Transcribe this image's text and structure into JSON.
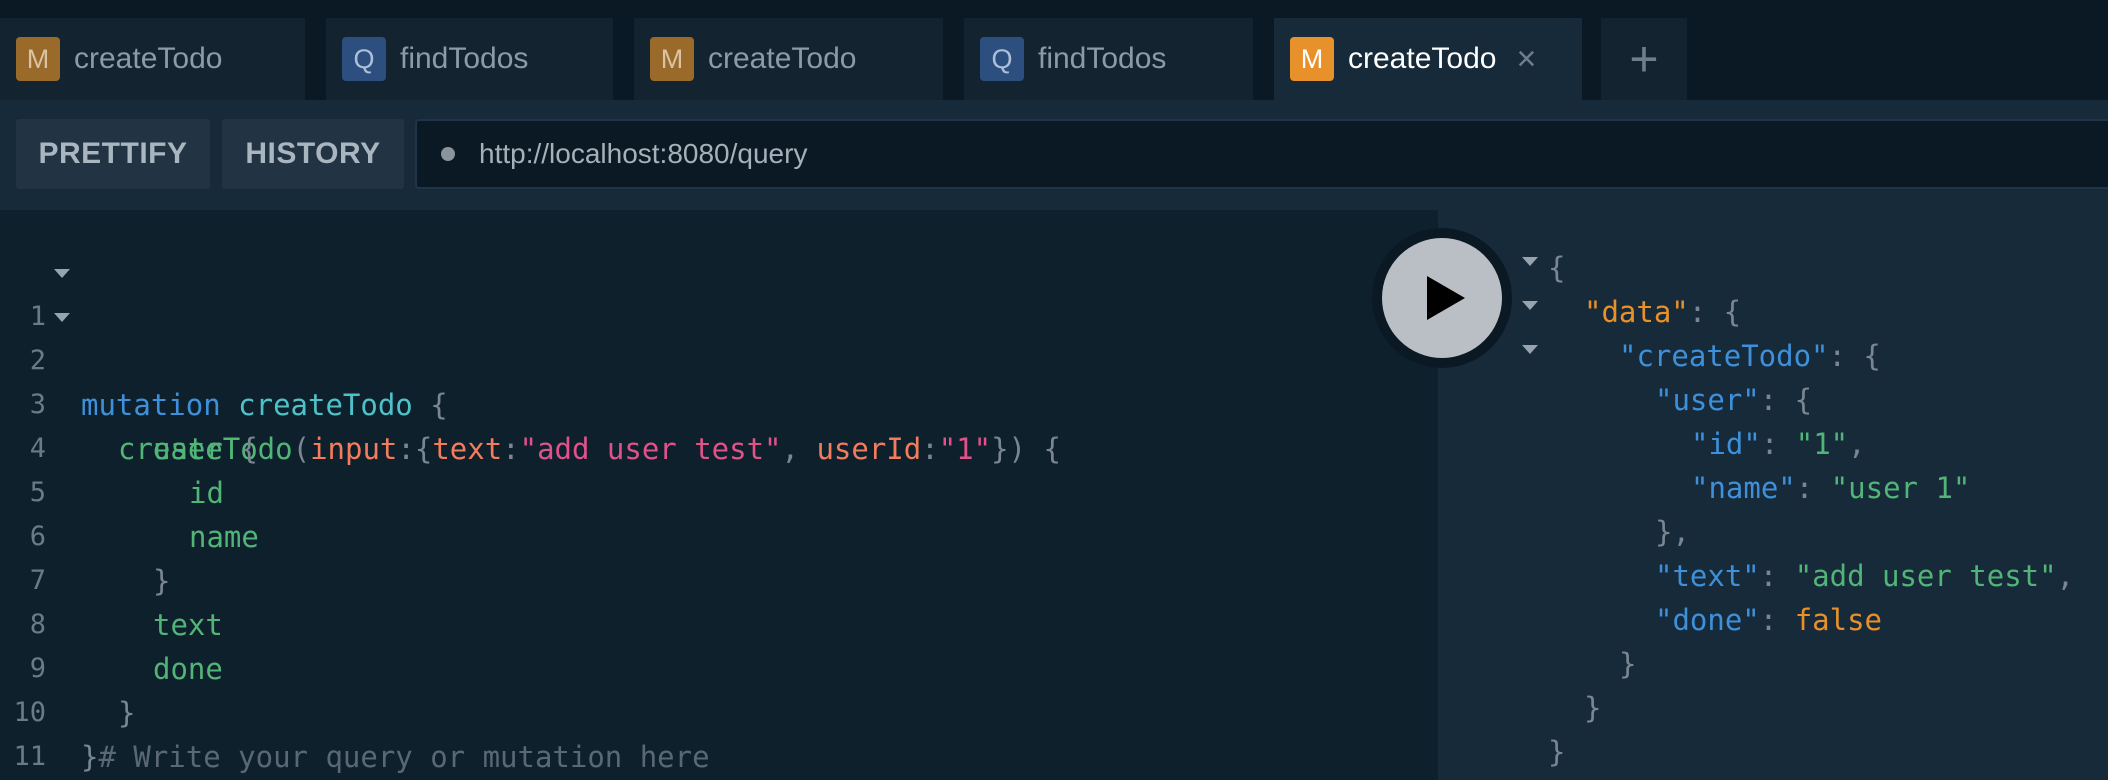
{
  "tabs": [
    {
      "badge": "M",
      "label": "createTodo"
    },
    {
      "badge": "Q",
      "label": "findTodos"
    },
    {
      "badge": "M",
      "label": "createTodo"
    },
    {
      "badge": "Q",
      "label": "findTodos"
    },
    {
      "badge": "M",
      "label": "createTodo",
      "close": "×"
    }
  ],
  "add_tab": "+",
  "toolbar": {
    "prettify": "PRETTIFY",
    "history": "HISTORY",
    "endpoint": "http://localhost:8080/query"
  },
  "editor": {
    "line_numbers": [
      "1",
      "2",
      "3",
      "4",
      "5",
      "6",
      "7",
      "8",
      "9",
      "10",
      "11"
    ],
    "l1": {
      "kw": "mutation",
      "name": "createTodo",
      "brace": "{"
    },
    "l2": {
      "field": "createTodo",
      "open": "(",
      "arg1": "input",
      "colon1": ":{",
      "arg2": "text",
      "colon2": ":",
      "val2": "\"add user test\"",
      "comma": ", ",
      "arg3": "userId",
      "colon3": ":",
      "val3": "\"1\"",
      "close": "}) {"
    },
    "l3": {
      "field": "user",
      "brace": "{"
    },
    "l4": {
      "field": "id"
    },
    "l5": {
      "field": "name"
    },
    "l6": {
      "brace": "}"
    },
    "l7": {
      "field": "text"
    },
    "l8": {
      "field": "done"
    },
    "l9": {
      "brace": "}"
    },
    "l10": {
      "brace": "}",
      "comment": "# Write your query or mutation here"
    }
  },
  "result": {
    "open": "{",
    "data_key": "\"data\"",
    "createTodo_key": "\"createTodo\"",
    "user_key": "\"user\"",
    "id_key": "\"id\"",
    "id_val": "\"1\"",
    "name_key": "\"name\"",
    "name_val": "\"user 1\"",
    "user_close": "},",
    "text_key": "\"text\"",
    "text_val": "\"add user test\"",
    "done_key": "\"done\"",
    "done_val": "false",
    "close": "}"
  }
}
